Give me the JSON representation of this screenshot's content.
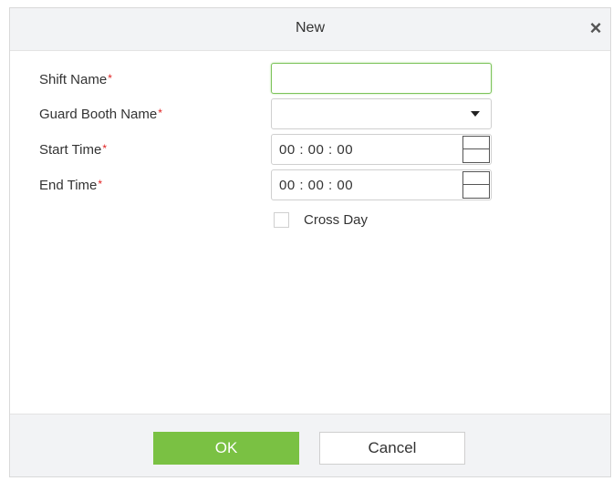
{
  "dialog": {
    "title": "New",
    "close_symbol": "×"
  },
  "form": {
    "required_marker": "*",
    "shift_name": {
      "label": "Shift Name",
      "value": ""
    },
    "guard_booth_name": {
      "label": "Guard Booth Name",
      "value": ""
    },
    "start_time": {
      "label": "Start Time",
      "value": "00 : 00 : 00"
    },
    "end_time": {
      "label": "End Time",
      "value": "00 : 00 : 00"
    },
    "cross_day": {
      "label": "Cross Day",
      "checked": false
    }
  },
  "footer": {
    "ok_label": "OK",
    "cancel_label": "Cancel"
  },
  "colors": {
    "ok_button": "#7ac143",
    "required_marker": "#e02020",
    "focus_border": "#7cc35a"
  }
}
